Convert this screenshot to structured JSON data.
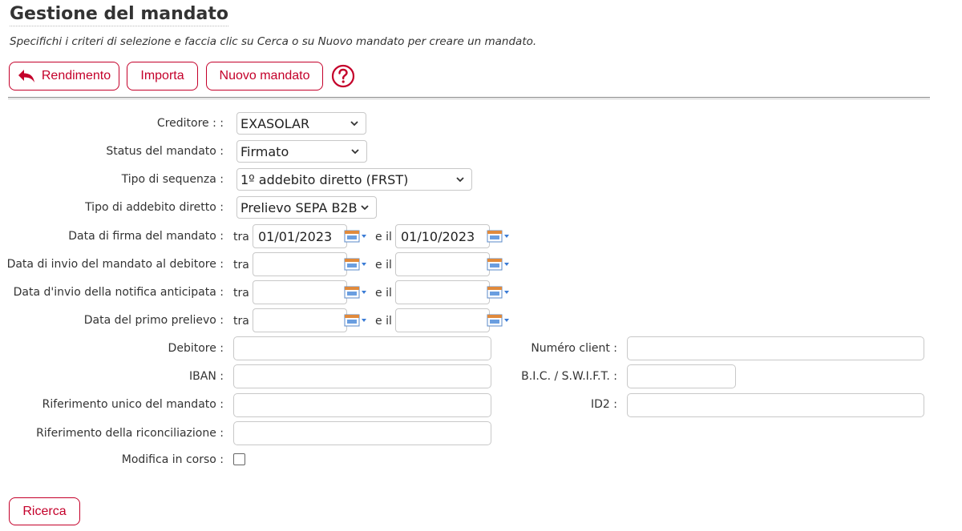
{
  "header": {
    "title": "Gestione del mandato",
    "subtitle": "Specifichi i criteri di selezione e faccia clic su Cerca o su Nuovo mandato per creare un mandato."
  },
  "toolbar": {
    "back_label": "Rendimento",
    "import_label": "Importa",
    "new_label": "Nuovo mandato"
  },
  "form": {
    "creditor_label": "Creditore : :",
    "creditor_value": "EXASOLAR",
    "status_label": "Status del mandato :",
    "status_value": "Firmato",
    "sequence_label": "Tipo di sequenza :",
    "sequence_value": "1º addebito diretto (FRST)",
    "debit_type_label": "Tipo di addebito diretto :",
    "debit_type_value": "Prelievo SEPA B2B",
    "range_from": "tra",
    "range_to": "e il",
    "sign_date_label": "Data di firma del mandato :",
    "sign_date_from": "01/01/2023",
    "sign_date_to": "01/10/2023",
    "send_date_label": "Data di invio del mandato al debitore :",
    "notice_date_label": "Data d'invio della notifica anticipata :",
    "first_debit_label": "Data del primo prelievo :",
    "debtor_label": "Debitore :",
    "client_number_label": "Numéro client :",
    "iban_label": "IBAN :",
    "bic_label": "B.I.C. / S.W.I.F.T. :",
    "mandate_ref_label": "Riferimento unico del mandato :",
    "id2_label": "ID2 :",
    "reconciliation_label": "Riferimento della riconciliazione :",
    "editing_label": "Modifica in corso :"
  },
  "footer": {
    "search_label": "Ricerca"
  },
  "colors": {
    "accent": "#c4002a",
    "calendar_blue": "#3a7bd5"
  }
}
